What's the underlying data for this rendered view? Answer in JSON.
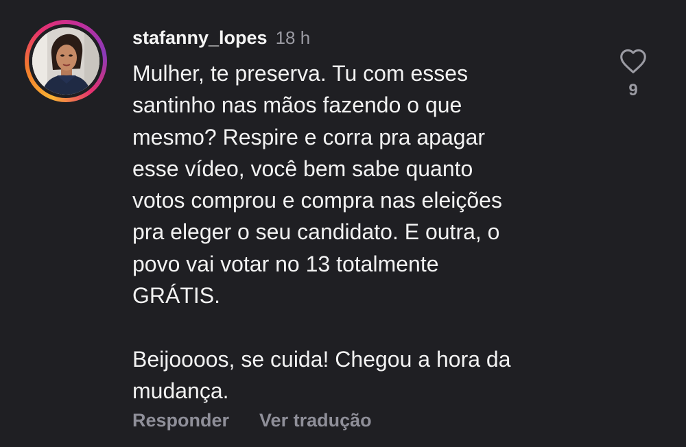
{
  "comment": {
    "username": "stafanny_lopes",
    "time": "18 h",
    "text": "Mulher, te preserva. Tu com esses\nsantinho nas mãos fazendo o que\nmesmo? Respire e corra pra apagar\nesse vídeo, você bem sabe quanto\nvotos comprou e compra nas eleições\npra eleger o seu candidato. E outra, o\npovo vai votar no 13 totalmente\nGRÁTIS.\n\nBeijoooos, se cuida! Chegou a hora da\nmudança.",
    "like_count": "9",
    "reply_label": "Responder",
    "translate_label": "Ver tradução",
    "icons": {
      "like": "heart-outline-icon"
    },
    "colors": {
      "background": "#1f1f23",
      "muted_text": "#9b9ba3",
      "story_ring": [
        "#f9b233",
        "#e6316f",
        "#8a3ab9"
      ]
    }
  }
}
